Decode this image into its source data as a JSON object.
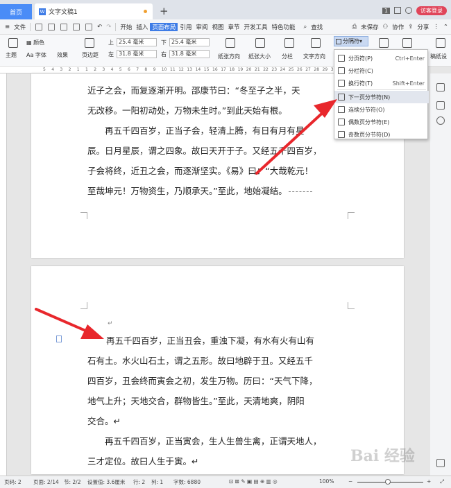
{
  "titlebar": {
    "home_tab": "首页",
    "doc_tab": "文字文稿1",
    "plus": "+",
    "badge": "1",
    "visitor_login": "访客登录"
  },
  "menubar": {
    "file": "文件",
    "items": [
      "开始",
      "插入",
      "页面布局",
      "引用",
      "审阅",
      "视图",
      "章节",
      "开发工具",
      "特色功能"
    ],
    "active_index": 2,
    "search": "查找",
    "unsaved": "未保存",
    "collab": "协作",
    "share": "分享"
  },
  "ribbon": {
    "theme": "主题",
    "color": "颜色",
    "font": "字体",
    "effects": "效果",
    "margins": "页边距",
    "top_label": "上",
    "top_value": "25.4 毫米",
    "bottom_label": "下",
    "bottom_value": "25.4 毫米",
    "left_label": "左",
    "left_value": "31.8 毫米",
    "right_label": "右",
    "right_value": "31.8 毫米",
    "orientation": "纸张方向",
    "size": "纸张大小",
    "columns": "分栏",
    "text_direction": "文字方向",
    "separator": "分隔符",
    "paper_settings": "稿纸设"
  },
  "dropdown": {
    "items": [
      {
        "label": "分页符(P)",
        "shortcut": "Ctrl+Enter"
      },
      {
        "label": "分栏符(C)",
        "shortcut": ""
      },
      {
        "label": "换行符(T)",
        "shortcut": "Shift+Enter"
      },
      {
        "label": "下一页分节符(N)",
        "shortcut": ""
      },
      {
        "label": "连续分节符(O)",
        "shortcut": ""
      },
      {
        "label": "偶数页分节符(E)",
        "shortcut": ""
      },
      {
        "label": "奇数页分节符(D)",
        "shortcut": ""
      }
    ],
    "highlighted_index": 3
  },
  "ruler": {
    "ticks": [
      "5",
      "4",
      "3",
      "2",
      "1",
      "1",
      "2",
      "3",
      "4",
      "5",
      "6",
      "7",
      "8",
      "9",
      "10",
      "11",
      "12",
      "13",
      "14",
      "15",
      "16",
      "17",
      "18",
      "19",
      "20",
      "21",
      "22",
      "23",
      "24",
      "25",
      "26",
      "27",
      "28",
      "29",
      "30",
      "31",
      "32",
      "33",
      "34",
      "35",
      "36",
      "37",
      "38",
      "39"
    ]
  },
  "page1": {
    "lines": [
      "近子之会，而复逐渐开明。邵康节曰：“冬至子之半，天",
      "无改移。一阳初动处，万物未生时。”到此天始有根。",
      "　　再五千四百岁，正当子会，轻清上腾，有日有月有星",
      "辰。日月星辰，谓之四象。故曰天开于子。又经五千四百岁，",
      "子会将终，近丑之会，而逐渐坚实。《易》曰：“大哉乾元！",
      "至哉坤元！万物资生，乃顺承天。”至此，地始凝结。"
    ]
  },
  "page2": {
    "lines": [
      "再五千四百岁，正当丑会，重浊下凝，有水有火有山有",
      "石有土。水火山石土，谓之五形。故曰地辟于丑。又经五千",
      "四百岁，丑会终而寅会之初，发生万物。历曰：“天气下降，",
      "地气上升；天地交合，群物皆生。”至此，天清地爽，阴阳",
      "交合。↵",
      "　　再五千四百岁，正当寅会，生人生兽生禽，正谓天地人，",
      "三才定位。故曰人生于寅。↵"
    ]
  },
  "statusbar": {
    "page": "页码: 2",
    "pages": "页面: 2/14",
    "section": "节: 2/2",
    "setting": "设置值: 3.6厘米",
    "row": "行: 2",
    "col": "列: 1",
    "words": "字数: 6880",
    "zoom": "100%"
  },
  "watermark": "Bai 经验"
}
